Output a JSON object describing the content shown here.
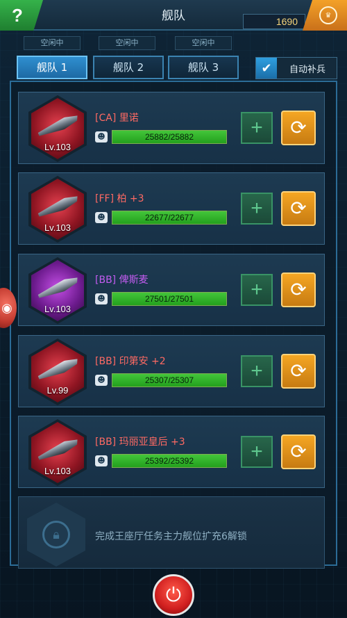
{
  "header": {
    "title": "舰队",
    "help_label": "?",
    "coins": "1690",
    "coin_icon": "crown-coin-icon"
  },
  "fleet_status": [
    "空闲中",
    "空闲中",
    "空闲中"
  ],
  "tabs": [
    {
      "label": "舰队 1",
      "active": true
    },
    {
      "label": "舰队 2",
      "active": false
    },
    {
      "label": "舰队 3",
      "active": false
    }
  ],
  "auto_resupply": {
    "label": "自动补兵",
    "checked": true
  },
  "ships": [
    {
      "name": "[CA] 里诺",
      "level": "Lv.103",
      "hp": "25882/25882",
      "hp_fraction": 1.0,
      "rarity": "red"
    },
    {
      "name": "[FF] 柏 +3",
      "level": "Lv.103",
      "hp": "22677/22677",
      "hp_fraction": 1.0,
      "rarity": "red"
    },
    {
      "name": "[BB] 俾斯麦",
      "level": "Lv.103",
      "hp": "27501/27501",
      "hp_fraction": 1.0,
      "rarity": "purple"
    },
    {
      "name": "[BB] 印第安 +2",
      "level": "Lv.99",
      "hp": "25307/25307",
      "hp_fraction": 1.0,
      "rarity": "red"
    },
    {
      "name": "[BB] 玛丽亚皇后 +3",
      "level": "Lv.103",
      "hp": "25392/25392",
      "hp_fraction": 1.0,
      "rarity": "red"
    }
  ],
  "locked_slot": {
    "text": "完成王座厅任务主力舰位扩充6解锁"
  },
  "colors": {
    "accent": "#2f8fd0",
    "hp_green": "#2bb32a",
    "swap_orange": "#f5a623",
    "red_name": "#ff6a63",
    "purple_name": "#c35cf0"
  }
}
